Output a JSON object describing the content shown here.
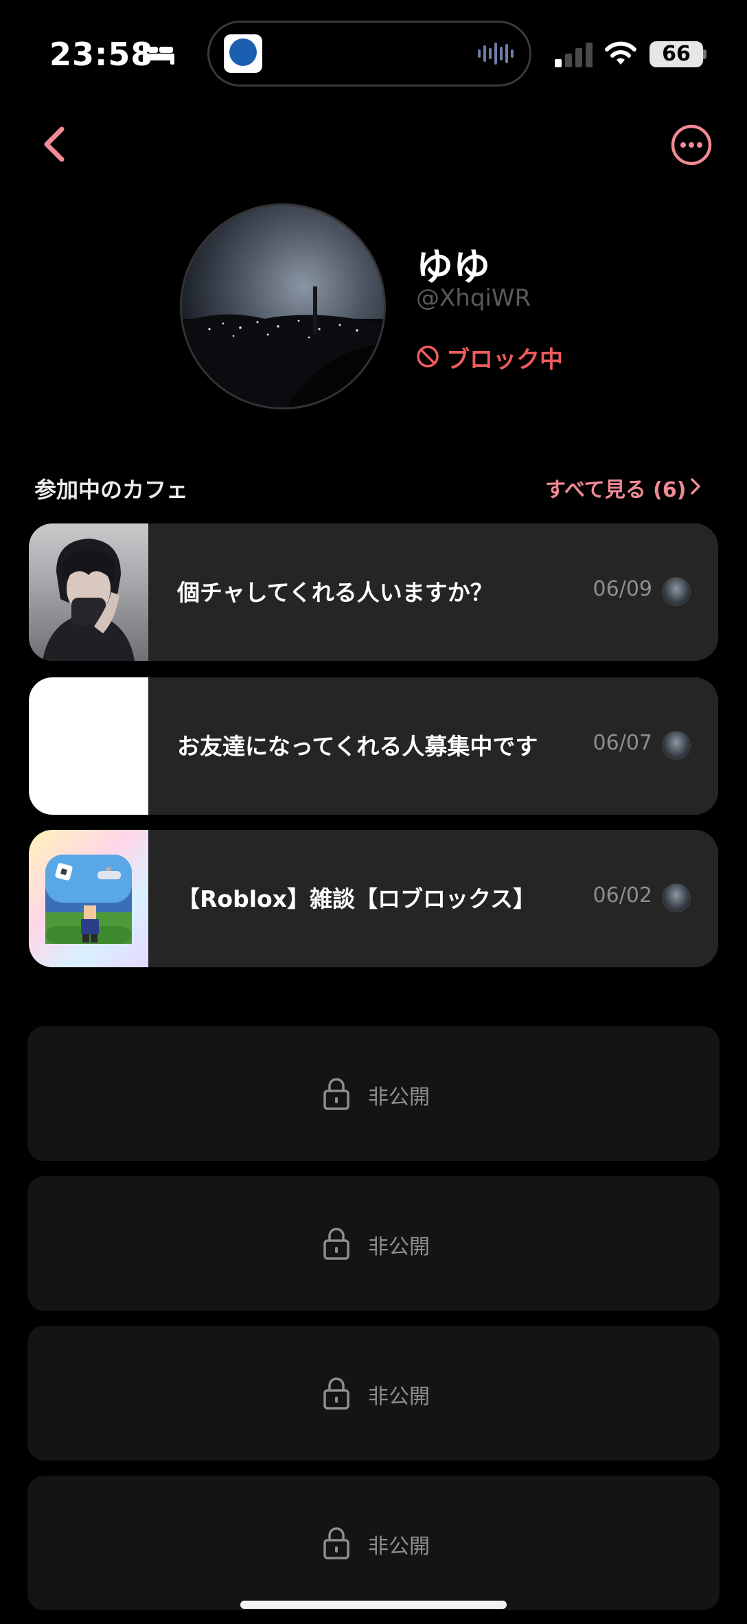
{
  "status_bar": {
    "time": "23:58",
    "battery": "66",
    "icons": [
      "bed-icon",
      "app-activity-icon",
      "waveform-icon",
      "signal-icon",
      "wifi-icon",
      "battery-icon"
    ]
  },
  "nav": {
    "back_icon": "chevron-left-icon",
    "more_icon": "ellipsis-circle-icon",
    "accent_color": "#f08a94"
  },
  "profile": {
    "name": "ゆゆ",
    "handle": "@XhqiWR",
    "block_status": "ブロック中",
    "block_color": "#f05b5b"
  },
  "cafes_section": {
    "title": "参加中のカフェ",
    "see_all": "すべて見る (6)",
    "items": [
      {
        "title": "個チャしてくれる人いますか？",
        "date": "06/09",
        "thumbnail": "person-photo"
      },
      {
        "title": "お友達になってくれる人募集中です",
        "date": "06/07",
        "thumbnail": "white-image"
      },
      {
        "title": "【Roblox】雑談【ロブロックス】",
        "date": "06/02",
        "thumbnail": "roblox-art"
      }
    ]
  },
  "private_items": [
    {
      "label": "非公開"
    },
    {
      "label": "非公開"
    },
    {
      "label": "非公開"
    },
    {
      "label": "非公開"
    }
  ]
}
